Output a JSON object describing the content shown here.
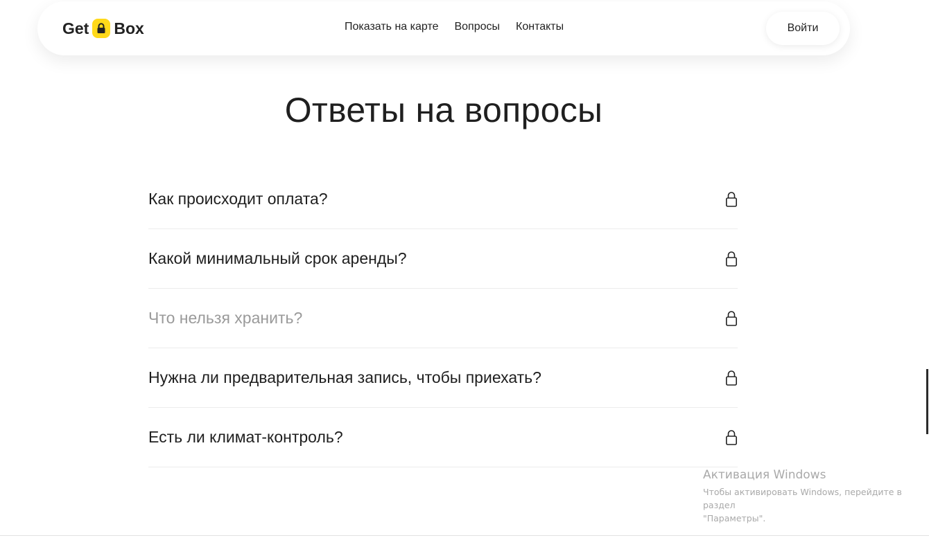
{
  "header": {
    "logo_left": "Get",
    "logo_right": "Box",
    "nav": [
      {
        "label": "Показать на карте"
      },
      {
        "label": "Вопросы"
      },
      {
        "label": "Контакты"
      }
    ],
    "login_label": "Войти"
  },
  "main": {
    "title": "Ответы на вопросы",
    "faq": [
      {
        "question": "Как происходит оплата?"
      },
      {
        "question": "Какой минимальный срок аренды?"
      },
      {
        "question": "Что нельзя хранить?"
      },
      {
        "question": "Нужна ли предварительная запись, чтобы приехать?"
      },
      {
        "question": "Есть ли климат-контроль?"
      }
    ]
  },
  "watermark": {
    "title": "Активация Windows",
    "line1": "Чтобы активировать Windows, перейдите в раздел",
    "line2": "\"Параметры\"."
  },
  "colors": {
    "accent": "#ffd91a",
    "text": "#1f1f1f",
    "muted": "#9a9a9a"
  },
  "icons": {
    "logo": "lock-icon",
    "faq_toggle": "lock-icon"
  }
}
